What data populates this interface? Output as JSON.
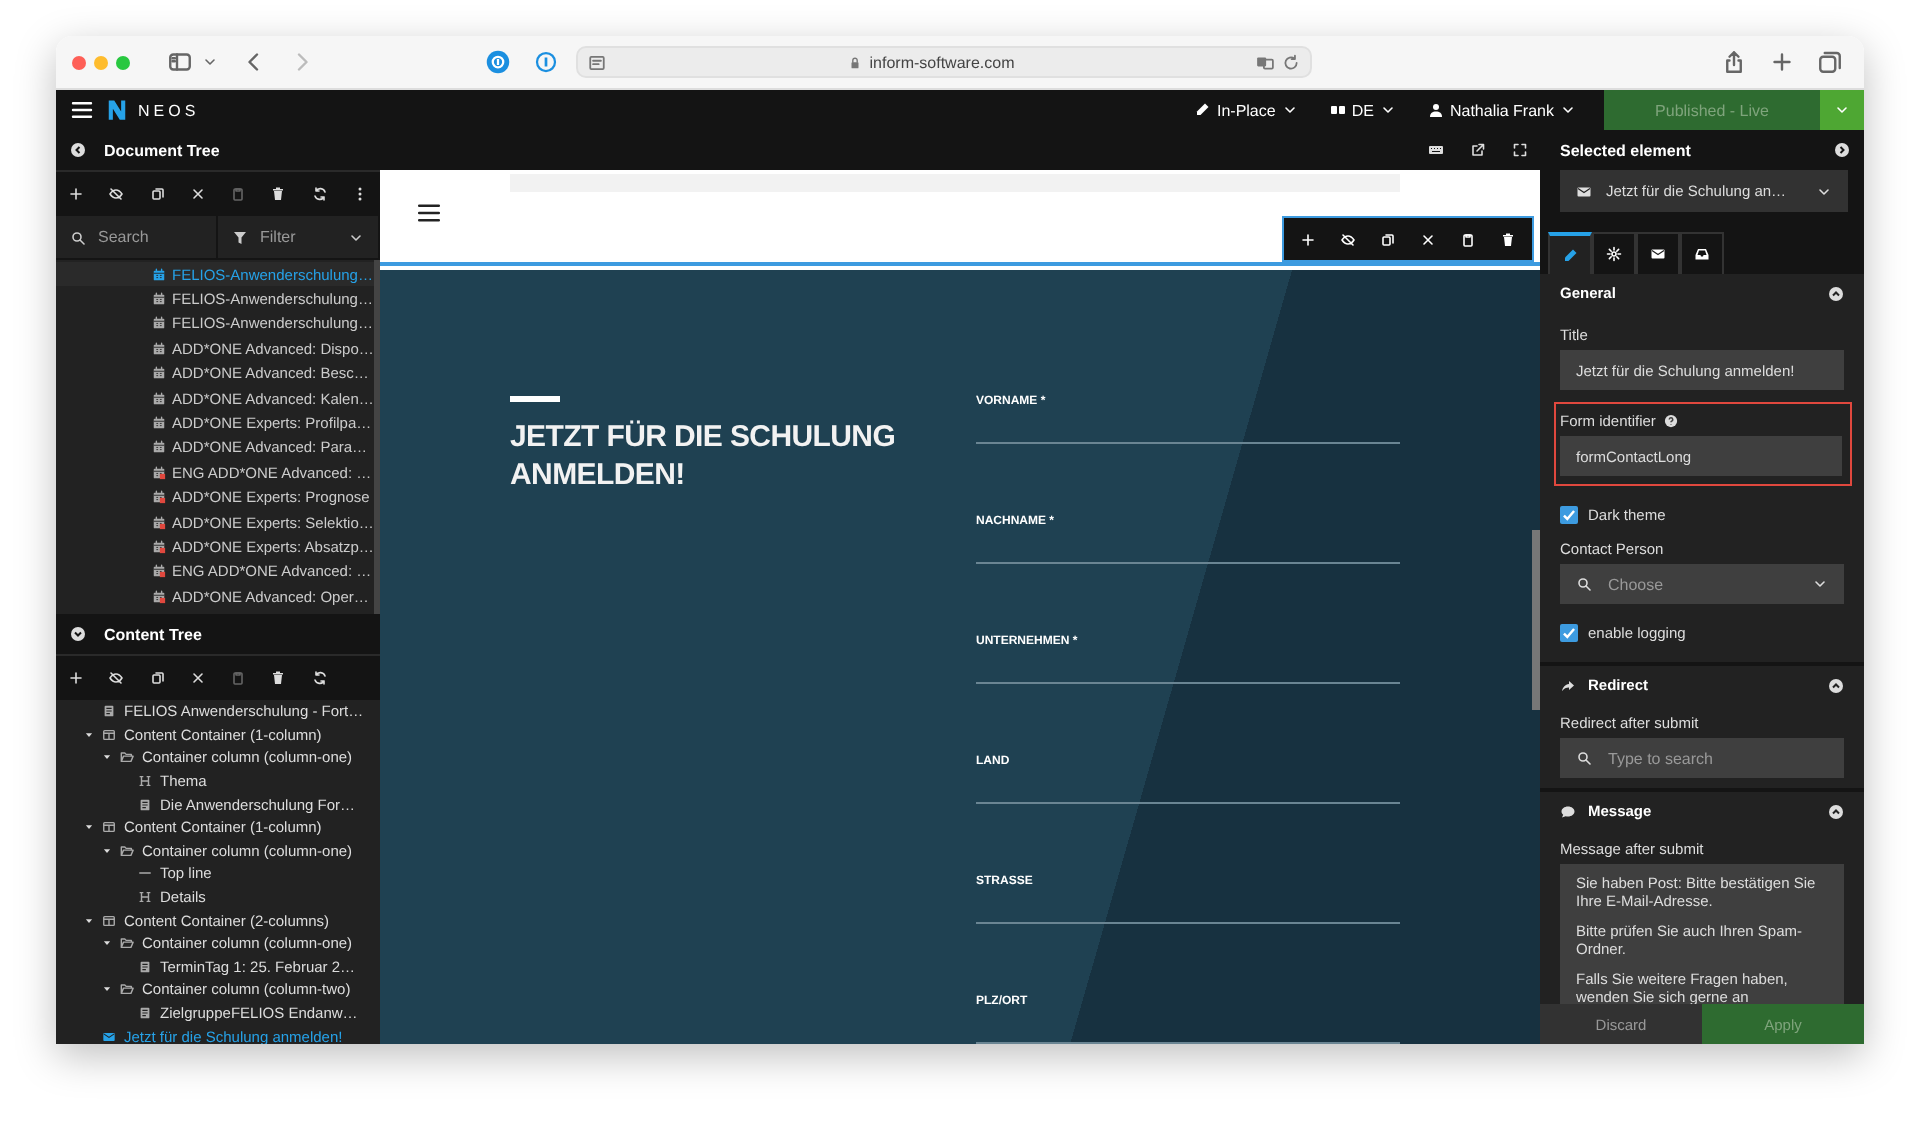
{
  "browser": {
    "url": "inform-software.com"
  },
  "topbar": {
    "brand": "NEOS",
    "mode": "In-Place",
    "language": "DE",
    "user": "Nathalia Frank",
    "publish": {
      "label": "Published - Live",
      "disabled": true
    }
  },
  "document_tree": {
    "title": "Document Tree",
    "search_placeholder": "Search",
    "filter_placeholder": "Filter",
    "items": [
      {
        "label": "FELIOS-Anwenderschulung…",
        "selected": true,
        "flagged": false
      },
      {
        "label": "FELIOS-Anwenderschulung…",
        "selected": false,
        "flagged": false
      },
      {
        "label": "FELIOS-Anwenderschulung…",
        "selected": false,
        "flagged": false
      },
      {
        "label": "ADD*ONE Advanced: Dispo…",
        "selected": false,
        "flagged": false
      },
      {
        "label": "ADD*ONE Advanced: Besc…",
        "selected": false,
        "flagged": false
      },
      {
        "label": "ADD*ONE Advanced: Kalen…",
        "selected": false,
        "flagged": false
      },
      {
        "label": "ADD*ONE Experts: Profilpa…",
        "selected": false,
        "flagged": false
      },
      {
        "label": "ADD*ONE Advanced: Para…",
        "selected": false,
        "flagged": false
      },
      {
        "label": "ENG ADD*ONE Advanced: …",
        "selected": false,
        "flagged": true
      },
      {
        "label": "ADD*ONE Experts: Prognose",
        "selected": false,
        "flagged": true
      },
      {
        "label": "ADD*ONE Experts: Selektio…",
        "selected": false,
        "flagged": true
      },
      {
        "label": "ADD*ONE Experts: Absatzp…",
        "selected": false,
        "flagged": true
      },
      {
        "label": "ENG ADD*ONE Advanced: …",
        "selected": false,
        "flagged": true
      },
      {
        "label": "ADD*ONE Advanced: Oper…",
        "selected": false,
        "flagged": true
      }
    ]
  },
  "content_tree": {
    "title": "Content Tree",
    "items": [
      {
        "kind": "text",
        "label": "FELIOS Anwenderschulung - Fort…",
        "selected": false
      },
      {
        "kind": "container",
        "label": "Content Container (1-column)",
        "selected": false,
        "expanded": true,
        "children": [
          {
            "kind": "column",
            "label": "Container column (column-one)",
            "selected": false,
            "expanded": true,
            "children": [
              {
                "kind": "heading",
                "label": "Thema",
                "selected": false
              },
              {
                "kind": "text",
                "label": "Die Anwenderschulung For…",
                "selected": false
              }
            ]
          }
        ]
      },
      {
        "kind": "container",
        "label": "Content Container (1-column)",
        "selected": false,
        "expanded": true,
        "children": [
          {
            "kind": "column",
            "label": "Container column (column-one)",
            "selected": false,
            "expanded": true,
            "children": [
              {
                "kind": "line",
                "label": "Top line",
                "selected": false
              },
              {
                "kind": "heading",
                "label": "Details",
                "selected": false
              }
            ]
          }
        ]
      },
      {
        "kind": "container",
        "label": "Content Container (2-columns)",
        "selected": false,
        "expanded": true,
        "children": [
          {
            "kind": "column",
            "label": "Container column (column-one)",
            "selected": false,
            "expanded": true,
            "children": [
              {
                "kind": "text",
                "label": "TerminTag 1: 25. Februar 2…",
                "selected": false
              }
            ]
          },
          {
            "kind": "column",
            "label": "Container column (column-two)",
            "selected": false,
            "expanded": true,
            "children": [
              {
                "kind": "text",
                "label": "ZielgruppeFELIOS Endanw…",
                "selected": false
              }
            ]
          }
        ]
      },
      {
        "kind": "form",
        "label": "Jetzt für die Schulung anmelden!",
        "selected": true
      }
    ]
  },
  "preview": {
    "heading": "JETZT FÜR DIE SCHULUNG ANMELDEN!",
    "fields": [
      {
        "label": "VORNAME *"
      },
      {
        "label": "NACHNAME *"
      },
      {
        "label": "UNTERNEHMEN *"
      },
      {
        "label": "LAND"
      },
      {
        "label": "STRASSE"
      },
      {
        "label": "PLZ/ORT"
      }
    ]
  },
  "inspector": {
    "title": "Selected element",
    "element": "Jetzt für die Schulung an…",
    "tabs": [
      {
        "kind": "pencil",
        "selected": true
      },
      {
        "kind": "gear",
        "selected": false
      },
      {
        "kind": "envelope",
        "selected": false
      },
      {
        "kind": "inbox",
        "selected": false
      }
    ],
    "sections": [
      {
        "title": "General",
        "kind": "general",
        "expanded": true,
        "props": [
          {
            "kind": "text",
            "label": "Title",
            "value": "Jetzt für die Schulung anmelden!",
            "help": false,
            "highlighted": false
          },
          {
            "kind": "text",
            "label": "Form identifier",
            "value": "formContactLong",
            "help": true,
            "highlighted": true
          },
          {
            "kind": "checkbox",
            "label": "Dark theme",
            "checked": true
          },
          {
            "kind": "select",
            "label": "Contact Person",
            "placeholder": "Choose"
          },
          {
            "kind": "checkbox",
            "label": "enable logging",
            "checked": true
          }
        ]
      },
      {
        "title": "Redirect",
        "kind": "redirect",
        "expanded": true,
        "props": [
          {
            "kind": "search",
            "label": "Redirect after submit",
            "placeholder": "Type to search"
          }
        ]
      },
      {
        "title": "Message",
        "kind": "message",
        "expanded": true,
        "props": [
          {
            "kind": "textarea",
            "label": "Message after submit",
            "paragraphs": [
              "Sie haben Post: Bitte bestätigen Sie Ihre E-Mail-Adresse.",
              "Bitte prüfen Sie auch Ihren Spam-Ordner.",
              "Falls Sie weitere Fragen haben, wenden Sie sich gerne an"
            ]
          }
        ]
      }
    ],
    "discard": "Discard",
    "apply": {
      "label": "Apply",
      "disabled": true
    }
  }
}
